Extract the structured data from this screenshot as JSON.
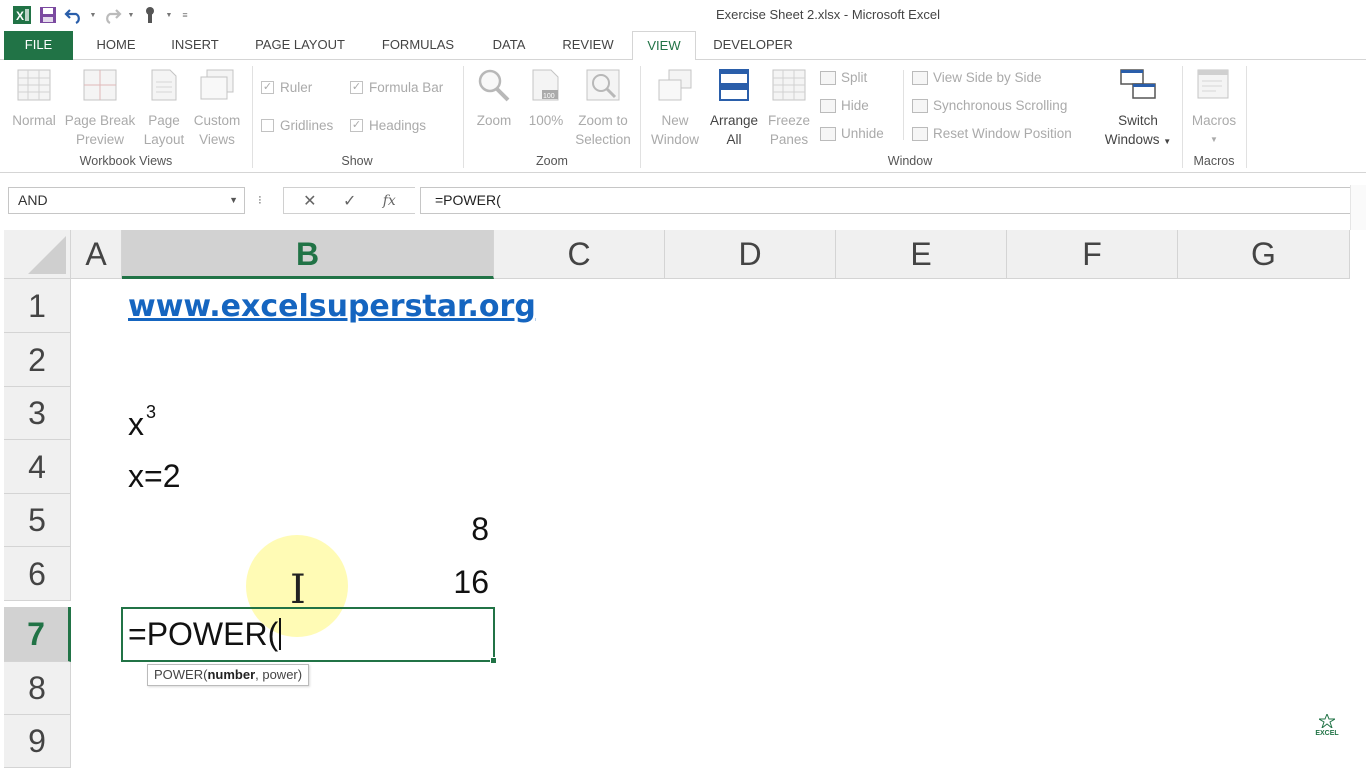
{
  "window": {
    "title": "Exercise Sheet 2.xlsx - Microsoft Excel",
    "accent": "#217346",
    "link_color": "#1565c0"
  },
  "qat": {
    "icons": [
      "excel-logo-icon",
      "save-icon",
      "undo-icon",
      "redo-icon",
      "touch-mode-icon",
      "customize-qat-icon"
    ]
  },
  "tabs": [
    "FILE",
    "HOME",
    "INSERT",
    "PAGE LAYOUT",
    "FORMULAS",
    "DATA",
    "REVIEW",
    "VIEW",
    "DEVELOPER"
  ],
  "active_tab": "VIEW",
  "ribbon": {
    "workbook_views": {
      "label": "Workbook Views",
      "normal": "Normal",
      "page_break_1": "Page Break",
      "page_break_2": "Preview",
      "page_layout_1": "Page",
      "page_layout_2": "Layout",
      "custom_views_1": "Custom",
      "custom_views_2": "Views"
    },
    "show": {
      "label": "Show",
      "ruler": "Ruler",
      "formula_bar": "Formula Bar",
      "gridlines": "Gridlines",
      "headings": "Headings"
    },
    "zoom": {
      "label": "Zoom",
      "zoom": "Zoom",
      "hundred": "100%",
      "zoom_sel_1": "Zoom to",
      "zoom_sel_2": "Selection"
    },
    "window": {
      "label": "Window",
      "new_window_1": "New",
      "new_window_2": "Window",
      "arrange_1": "Arrange",
      "arrange_2": "All",
      "freeze_1": "Freeze",
      "freeze_2": "Panes",
      "split": "Split",
      "hide": "Hide",
      "unhide": "Unhide",
      "side_by_side": "View Side by Side",
      "sync_scroll": "Synchronous Scrolling",
      "reset_pos": "Reset Window Position",
      "switch_1": "Switch",
      "switch_2": "Windows"
    },
    "macros": {
      "label": "Macros",
      "macros": "Macros"
    }
  },
  "formula_bar": {
    "name_box": "AND",
    "cancel": "✕",
    "enter": "✓",
    "fx": "fx",
    "formula": "=POWER("
  },
  "columns": [
    "A",
    "B",
    "C",
    "D",
    "E",
    "F",
    "G"
  ],
  "selected_column": "B",
  "rows": [
    "1",
    "2",
    "3",
    "4",
    "5",
    "6",
    "7",
    "8",
    "9"
  ],
  "selected_row": "7",
  "cells": {
    "b1": "www.excelsuperstar.org",
    "b3_base": "x",
    "b3_exp": "3",
    "b4": "x=2",
    "b5": "8",
    "b6": "16",
    "b7": "=POWER("
  },
  "tooltip": {
    "fn": "POWER(",
    "arg1": "number",
    "rest": ", power)"
  },
  "logo_text": "EXCEL"
}
